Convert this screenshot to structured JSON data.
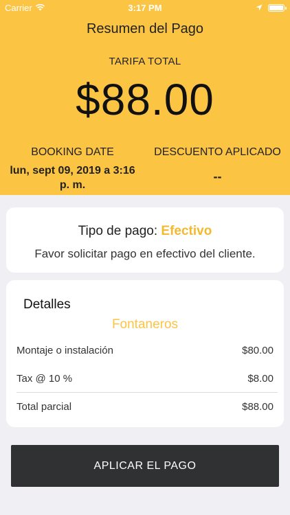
{
  "status_bar": {
    "carrier": "Carrier",
    "time": "3:17 PM"
  },
  "header": {
    "title": "Resumen del Pago",
    "fare_label": "TARIFA TOTAL",
    "fare_amount": "$88.00",
    "booking_date_label": "BOOKING DATE",
    "booking_date_value": "lun, sept 09, 2019 a 3:16 p. m.",
    "discount_label": "DESCUENTO APLICADO",
    "discount_value": "--"
  },
  "payment": {
    "type_label": "Tipo de pago:",
    "type_value": "Efectivo",
    "note": "Favor solicitar pago en efectivo del cliente."
  },
  "details": {
    "title": "Detalles",
    "service": "Fontaneros",
    "rows": [
      {
        "label": "Montaje o instalación",
        "value": "$80.00"
      },
      {
        "label": "Tax @ 10 %",
        "value": "$8.00"
      },
      {
        "label": "Total parcial",
        "value": "$88.00"
      }
    ]
  },
  "actions": {
    "apply_label": "APLICAR EL PAGO"
  },
  "colors": {
    "accent": "#fcc443",
    "payment_method": "#f5b82e",
    "button_bg": "#2f3133",
    "background": "#efeff4"
  }
}
